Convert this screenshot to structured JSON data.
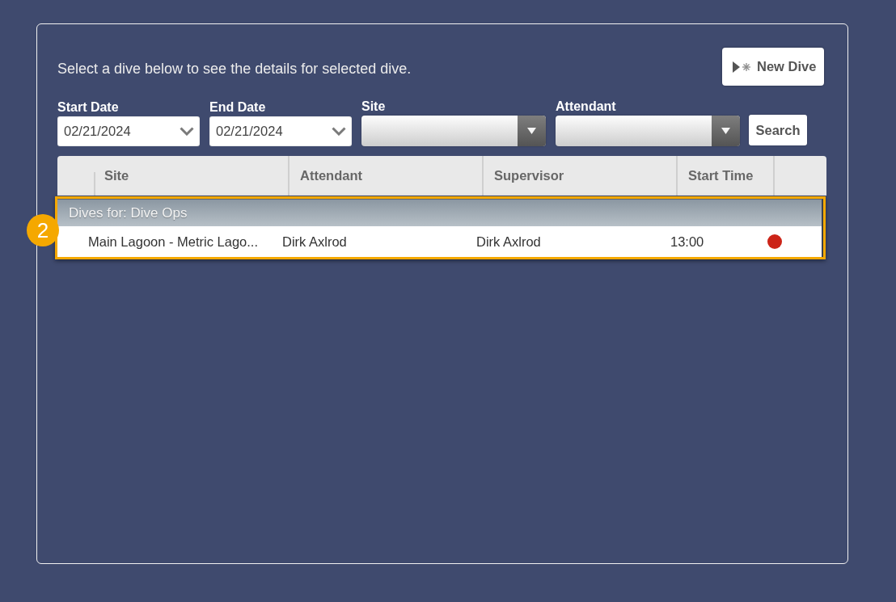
{
  "intro": "Select a dive below to see the details for selected dive.",
  "new_dive_button": {
    "label": "New Dive"
  },
  "filters": [
    {
      "kind": "date",
      "label": "Start Date",
      "value": "02/21/2024"
    },
    {
      "kind": "date",
      "label": "End Date",
      "value": "02/21/2024"
    },
    {
      "kind": "select",
      "label": "Site"
    },
    {
      "kind": "select",
      "label": "Attendant"
    }
  ],
  "search_button": {
    "label": "Search"
  },
  "table": {
    "columns": [
      "Site",
      "Attendant",
      "Supervisor",
      "Start Time"
    ],
    "groups": [
      {
        "label": "Dives for: Dive Ops",
        "highlighted": true,
        "callout": "2",
        "rows": [
          {
            "site": "Main Lagoon - Metric Lago...",
            "attendant": "Dirk Axlrod",
            "supervisor": "Dirk Axlrod",
            "start_time": "13:00",
            "color": "#cc2418"
          }
        ]
      }
    ]
  }
}
